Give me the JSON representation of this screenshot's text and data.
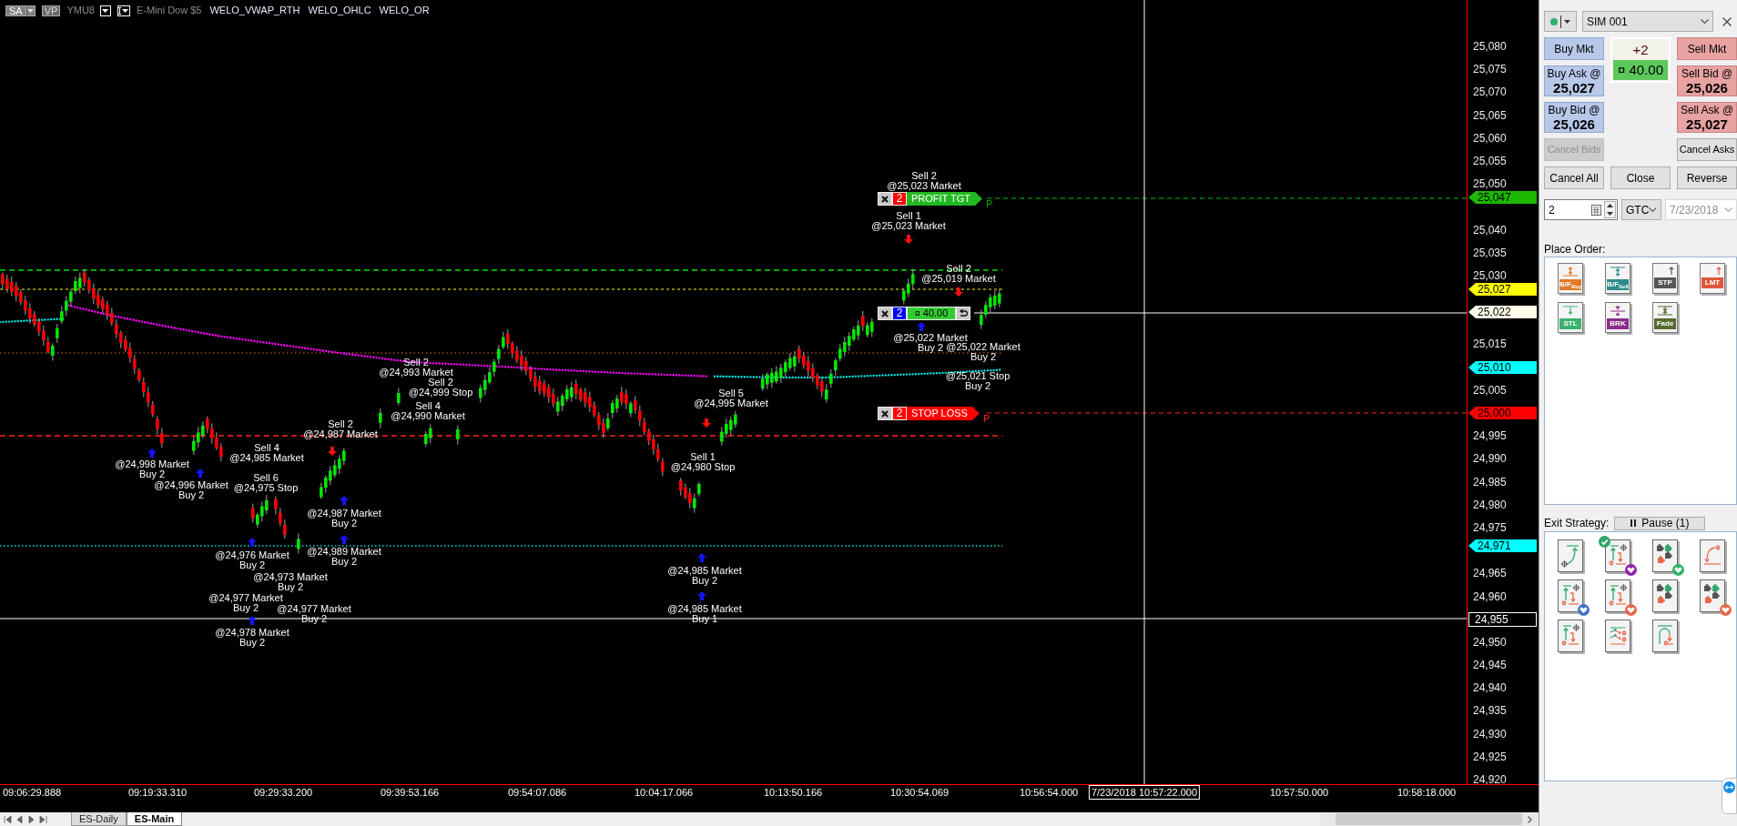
{
  "chart": {
    "header": {
      "mode_button": "SA",
      "profile_button": "VP",
      "symbol": "YMU8",
      "description": "E-Mini Dow $5",
      "indicators": [
        "WELO_VWAP_RTH",
        "WELO_OHLC",
        "WELO_OR"
      ]
    },
    "orders": [
      {
        "kind": "target",
        "quantity": "2",
        "label": "PROFIT TGT",
        "flag": "P"
      },
      {
        "kind": "position",
        "quantity": "2",
        "label": "¤ 40.00"
      },
      {
        "kind": "stop",
        "quantity": "2",
        "label": "STOP LOSS",
        "flag": "P"
      }
    ],
    "annotations": [
      {
        "lines": [
          "Sell 2",
          "@25,023 Market"
        ]
      },
      {
        "lines": [
          "Sell 1",
          "@25,023 Market"
        ]
      },
      {
        "lines": [
          "Sell 2",
          "@25,019 Market"
        ]
      },
      {
        "lines": [
          "@25,022 Market",
          "Buy 2"
        ]
      },
      {
        "lines": [
          "@25,022 Market",
          "Buy 2"
        ]
      },
      {
        "lines": [
          "Sell 2",
          "@24,993 Market"
        ]
      },
      {
        "lines": [
          "Sell 2",
          "@24,999 Stop"
        ]
      },
      {
        "lines": [
          "@25,021 Stop",
          "Buy 2"
        ]
      },
      {
        "lines": [
          "Sell 5",
          "@24,995 Market"
        ]
      },
      {
        "lines": [
          "Sell 4",
          "@24,990 Market"
        ]
      },
      {
        "lines": [
          "Sell 2",
          "@24,987 Market"
        ]
      },
      {
        "lines": [
          "Sell 4",
          "@24,985 Market"
        ]
      },
      {
        "lines": [
          "@24,998 Market",
          "Buy 2"
        ]
      },
      {
        "lines": [
          "Sell 1",
          "@24,980 Stop"
        ]
      },
      {
        "lines": [
          "@24,996 Market",
          "Buy 2"
        ]
      },
      {
        "lines": [
          "Sell 6",
          "@24,975 Stop"
        ]
      },
      {
        "lines": [
          "@24,987 Market",
          "Buy 2"
        ]
      },
      {
        "lines": [
          "@24,976 Market",
          "Buy 2"
        ]
      },
      {
        "lines": [
          "@24,989 Market",
          "Buy 2"
        ]
      },
      {
        "lines": [
          "@24,973 Market",
          "Buy 2"
        ]
      },
      {
        "lines": [
          "@24,985 Market",
          "Buy 2"
        ]
      },
      {
        "lines": [
          "@24,977 Market",
          "Buy 2"
        ]
      },
      {
        "lines": [
          "@24,977 Market",
          "Buy 2"
        ]
      },
      {
        "lines": [
          "@24,985 Market",
          "Buy 1"
        ]
      },
      {
        "lines": [
          "@24,978 Market",
          "Buy 2"
        ]
      }
    ],
    "price_axis": {
      "labels": [
        "25,080",
        "25,075",
        "25,070",
        "25,065",
        "25,060",
        "25,055",
        "25,050",
        "25,040",
        "25,035",
        "25,030",
        "25,015",
        "25,005",
        "24,995",
        "24,990",
        "24,985",
        "24,980",
        "24,975",
        "24,965",
        "24,960",
        "24,950",
        "24,945",
        "24,940",
        "24,935",
        "24,930",
        "24,925",
        "24,920"
      ],
      "tags": [
        {
          "kind": "level",
          "label": "25,047",
          "color": "#1db800"
        },
        {
          "kind": "level",
          "label": "25,027",
          "color": "#ffff00"
        },
        {
          "kind": "level",
          "label": "25,022",
          "color": "#fffde8"
        },
        {
          "kind": "level",
          "label": "25,010",
          "color": "#00ffff"
        },
        {
          "kind": "level",
          "label": "25,000",
          "color": "#ff0000"
        },
        {
          "kind": "level",
          "label": "24,971",
          "color": "#00ffff"
        },
        {
          "kind": "cursor",
          "label": "24,955"
        }
      ]
    },
    "time_axis": {
      "labels": [
        "09:06:29.888",
        "09:19:33.310",
        "09:29:33.200",
        "09:39:53.166",
        "09:54:07.086",
        "10:04:17.066",
        "10:13:50.166",
        "10:30:54.069",
        "10:56:54.000",
        "10:57:50.000",
        "10:58:18.000"
      ],
      "cursor_time": "7/23/2018 10:57:22.000"
    }
  },
  "sheet_tabs": [
    {
      "label": "ES-Daily",
      "selected": false
    },
    {
      "label": "ES-Main",
      "selected": true
    }
  ],
  "order_panel": {
    "connected": true,
    "account": "SIM 001",
    "market_buttons": [
      {
        "kind": "buy",
        "label": "Buy Mkt"
      },
      {
        "kind": "sell",
        "label": "Sell Mkt"
      }
    ],
    "position": "+2",
    "pnl": "¤ 40.00",
    "quote_buttons": [
      {
        "kind": "buy",
        "label": "Buy Ask @",
        "price": "25,027"
      },
      {
        "kind": "sell",
        "label": "Sell Bid @",
        "price": "25,026"
      },
      {
        "kind": "buy",
        "label": "Buy Bid @",
        "price": "25,026"
      },
      {
        "kind": "sell",
        "label": "Sell Ask @",
        "price": "25,027"
      }
    ],
    "cancel_buttons": [
      {
        "label": "Cancel Bids",
        "disabled": true
      },
      {
        "label": "Cancel Asks",
        "disabled": false
      }
    ],
    "action_buttons": [
      "Cancel All",
      "Close",
      "Reverse"
    ],
    "quantity": "2",
    "time_in_force": "GTC",
    "date": {
      "value": "7/23/2018",
      "disabled": true
    },
    "place_order_label": "Place Order:",
    "order_types": [
      {
        "kind": "buy_bf",
        "label": "B/F$_{Buy}$"
      },
      {
        "kind": "sell_bf",
        "label": "B/F$_{Sell}$"
      },
      {
        "kind": "stop",
        "label": "STP"
      },
      {
        "kind": "limit",
        "label": "LMT"
      },
      {
        "kind": "settle",
        "label": "STL"
      },
      {
        "kind": "break",
        "label": "BRK"
      },
      {
        "kind": "fade",
        "label": "Fade"
      }
    ],
    "exit_strategy_label": "Exit Strategy:",
    "pause_button": "Pause (1)",
    "exit_strategies": [
      {
        "kind": "curve",
        "selected": false
      },
      {
        "kind": "bracket",
        "selected": true,
        "color": "#8e24aa"
      },
      {
        "kind": "puzzle",
        "selected": false,
        "color": "#2fb56a"
      },
      {
        "kind": "stop_curve",
        "selected": false
      },
      {
        "kind": "bracket",
        "selected": false,
        "color": "#4472c4"
      },
      {
        "kind": "bracket",
        "selected": false,
        "color": "#e8684a"
      },
      {
        "kind": "puzzle",
        "selected": false
      },
      {
        "kind": "puzzle",
        "selected": false,
        "color": "#e8684a"
      },
      {
        "kind": "bracket",
        "selected": false
      },
      {
        "kind": "scale",
        "selected": false
      },
      {
        "kind": "arc",
        "selected": false
      }
    ]
  }
}
